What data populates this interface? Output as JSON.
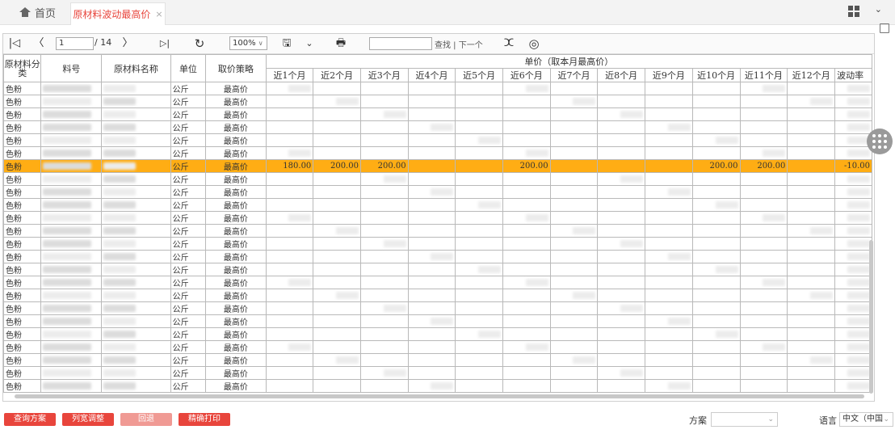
{
  "tabs": {
    "home_label": "首页",
    "active_label": "原材料波动最高价",
    "close_glyph": "×",
    "menu_glyph": "⌄"
  },
  "toolbar": {
    "first_glyph": "|◁",
    "prev_glyph": "〈",
    "page_value": "1",
    "page_total": "/ 14",
    "next_glyph": "〉",
    "last_glyph": "▷|",
    "refresh_glyph": "↻",
    "zoom_value": "100%",
    "save_glyph": "🖫",
    "save_dropdown_glyph": "⌄",
    "print_glyph": "🖶",
    "find_text": "查找 | 下一个",
    "rss_glyph": "ⵋ",
    "camera_glyph": "◎"
  },
  "table": {
    "headers": {
      "category": "原材料分类",
      "item_no": "料号",
      "material_name": "原材料名称",
      "unit": "单位",
      "strategy": "取价策略",
      "price_group": "单价（取本月最高价）",
      "months": [
        "近1个月",
        "近2个月",
        "近3个月",
        "近4个月",
        "近5个月",
        "近6个月",
        "近7个月",
        "近8个月",
        "近9个月",
        "近10个月",
        "近11个月",
        "近12个月"
      ],
      "volatility": "波动率"
    },
    "rows": [
      {
        "category": "色粉",
        "unit": "公斤",
        "strategy": "最高价",
        "months": [
          "",
          "",
          "",
          "",
          "",
          "",
          "",
          "",
          "",
          "",
          "",
          ""
        ],
        "volatility": ""
      },
      {
        "category": "色粉",
        "unit": "公斤",
        "strategy": "最高价",
        "months": [
          "",
          "",
          "",
          "",
          "",
          "",
          "",
          "",
          "",
          "",
          "",
          ""
        ],
        "volatility": ""
      },
      {
        "category": "色粉",
        "unit": "公斤",
        "strategy": "最高价",
        "months": [
          "",
          "",
          "",
          "",
          "",
          "",
          "",
          "",
          "",
          "",
          "",
          ""
        ],
        "volatility": ""
      },
      {
        "category": "色粉",
        "unit": "公斤",
        "strategy": "最高价",
        "months": [
          "",
          "",
          "",
          "",
          "",
          "",
          "",
          "",
          "",
          "",
          "",
          ""
        ],
        "volatility": ""
      },
      {
        "category": "色粉",
        "unit": "公斤",
        "strategy": "最高价",
        "months": [
          "",
          "",
          "",
          "",
          "",
          "",
          "",
          "",
          "",
          "",
          "",
          ""
        ],
        "volatility": ""
      },
      {
        "category": "色粉",
        "unit": "公斤",
        "strategy": "最高价",
        "months": [
          "",
          "",
          "",
          "",
          "",
          "",
          "",
          "",
          "",
          "",
          "",
          ""
        ],
        "volatility": ""
      },
      {
        "category": "色粉",
        "unit": "公斤",
        "strategy": "最高价",
        "months": [
          "180.00",
          "200.00",
          "200.00",
          "",
          "",
          "200.00",
          "",
          "",
          "",
          "200.00",
          "200.00",
          ""
        ],
        "volatility": "-10.00",
        "highlighted": true
      },
      {
        "category": "色粉",
        "unit": "公斤",
        "strategy": "最高价",
        "months": [
          "",
          "",
          "",
          "",
          "",
          "",
          "",
          "",
          "",
          "",
          "",
          ""
        ],
        "volatility": ""
      },
      {
        "category": "色粉",
        "unit": "公斤",
        "strategy": "最高价",
        "months": [
          "",
          "",
          "",
          "",
          "",
          "",
          "",
          "",
          "",
          "",
          "",
          ""
        ],
        "volatility": ""
      },
      {
        "category": "色粉",
        "unit": "公斤",
        "strategy": "最高价",
        "months": [
          "",
          "",
          "",
          "",
          "",
          "",
          "",
          "",
          "",
          "",
          "",
          ""
        ],
        "volatility": ""
      },
      {
        "category": "色粉",
        "unit": "公斤",
        "strategy": "最高价",
        "months": [
          "",
          "",
          "",
          "",
          "",
          "",
          "",
          "",
          "",
          "",
          "",
          ""
        ],
        "volatility": ""
      },
      {
        "category": "色粉",
        "unit": "公斤",
        "strategy": "最高价",
        "months": [
          "",
          "",
          "",
          "",
          "",
          "",
          "",
          "",
          "",
          "",
          "",
          ""
        ],
        "volatility": ""
      },
      {
        "category": "色粉",
        "unit": "公斤",
        "strategy": "最高价",
        "months": [
          "",
          "",
          "",
          "",
          "",
          "",
          "",
          "",
          "",
          "",
          "",
          ""
        ],
        "volatility": ""
      },
      {
        "category": "色粉",
        "unit": "公斤",
        "strategy": "最高价",
        "months": [
          "",
          "",
          "",
          "",
          "",
          "",
          "",
          "",
          "",
          "",
          "",
          ""
        ],
        "volatility": ""
      },
      {
        "category": "色粉",
        "unit": "公斤",
        "strategy": "最高价",
        "months": [
          "",
          "",
          "",
          "",
          "",
          "",
          "",
          "",
          "",
          "",
          "",
          ""
        ],
        "volatility": ""
      },
      {
        "category": "色粉",
        "unit": "公斤",
        "strategy": "最高价",
        "months": [
          "",
          "",
          "",
          "",
          "",
          "",
          "",
          "",
          "",
          "",
          "",
          ""
        ],
        "volatility": ""
      },
      {
        "category": "色粉",
        "unit": "公斤",
        "strategy": "最高价",
        "months": [
          "",
          "",
          "",
          "",
          "",
          "",
          "",
          "",
          "",
          "",
          "",
          ""
        ],
        "volatility": ""
      },
      {
        "category": "色粉",
        "unit": "公斤",
        "strategy": "最高价",
        "months": [
          "",
          "",
          "",
          "",
          "",
          "",
          "",
          "",
          "",
          "",
          "",
          ""
        ],
        "volatility": ""
      },
      {
        "category": "色粉",
        "unit": "公斤",
        "strategy": "最高价",
        "months": [
          "",
          "",
          "",
          "",
          "",
          "",
          "",
          "",
          "",
          "",
          "",
          ""
        ],
        "volatility": ""
      },
      {
        "category": "色粉",
        "unit": "公斤",
        "strategy": "最高价",
        "months": [
          "",
          "",
          "",
          "",
          "",
          "",
          "",
          "",
          "",
          "",
          "",
          ""
        ],
        "volatility": ""
      },
      {
        "category": "色粉",
        "unit": "公斤",
        "strategy": "最高价",
        "months": [
          "",
          "",
          "",
          "",
          "",
          "",
          "",
          "",
          "",
          "",
          "",
          ""
        ],
        "volatility": ""
      },
      {
        "category": "色粉",
        "unit": "公斤",
        "strategy": "最高价",
        "months": [
          "",
          "",
          "",
          "",
          "",
          "",
          "",
          "",
          "",
          "",
          "",
          ""
        ],
        "volatility": ""
      },
      {
        "category": "色粉",
        "unit": "公斤",
        "strategy": "最高价",
        "months": [
          "",
          "",
          "",
          "",
          "",
          "",
          "",
          "",
          "",
          "",
          "",
          ""
        ],
        "volatility": ""
      },
      {
        "category": "色粉",
        "unit": "公斤",
        "strategy": "最高价",
        "months": [
          "",
          "",
          "",
          "",
          "",
          "",
          "",
          "",
          "",
          "",
          "",
          ""
        ],
        "volatility": ""
      }
    ]
  },
  "bottom": {
    "btn_query_plan": "查询方案",
    "btn_column_adjust": "列宽调整",
    "btn_rollback": "回退",
    "btn_precise_print": "精确打印",
    "plan_label": "方案",
    "plan_value": "",
    "lang_label": "语言",
    "lang_value": "中文（中国",
    "dropdown_glyph": "⌄"
  },
  "colors": {
    "accent": "#e8453c",
    "highlight_row": "#ffad14"
  }
}
